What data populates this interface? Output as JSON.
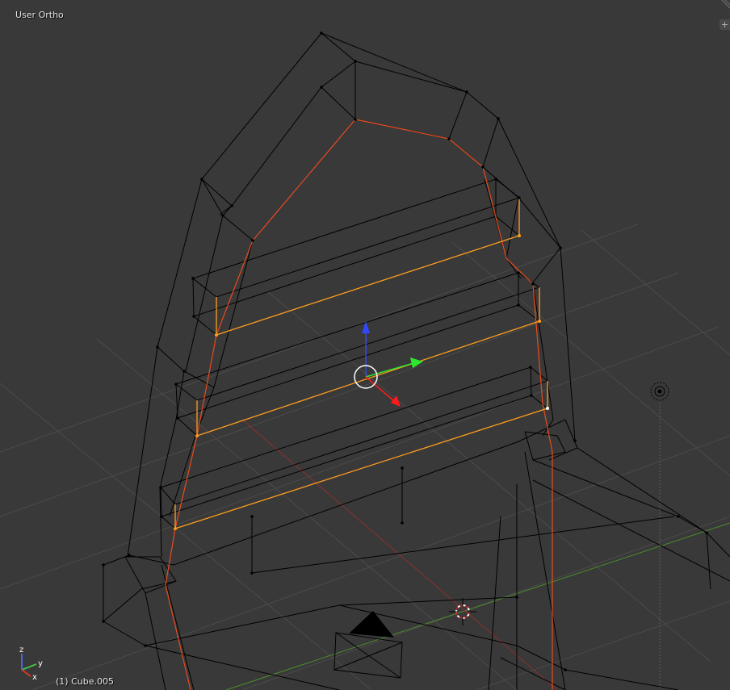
{
  "viewport": {
    "view_name": "User Ortho",
    "active_object": "(1) Cube.005",
    "background_color": "#393939"
  },
  "overlay": {
    "toggle_glyph": "+"
  },
  "axis_gizmo": {
    "labels": {
      "x": "x",
      "y": "y",
      "z": "z"
    },
    "colors": {
      "x": "#d8382c",
      "y": "#43c343",
      "z": "#4a63e6"
    }
  },
  "colors": {
    "wire": "#000000",
    "selected_edge": "#ff9d1e",
    "seam": "#e84b1e",
    "grid": "#4d4d4d",
    "axis_x_line": "#a43434",
    "axis_y_line": "#4a8f2a"
  }
}
